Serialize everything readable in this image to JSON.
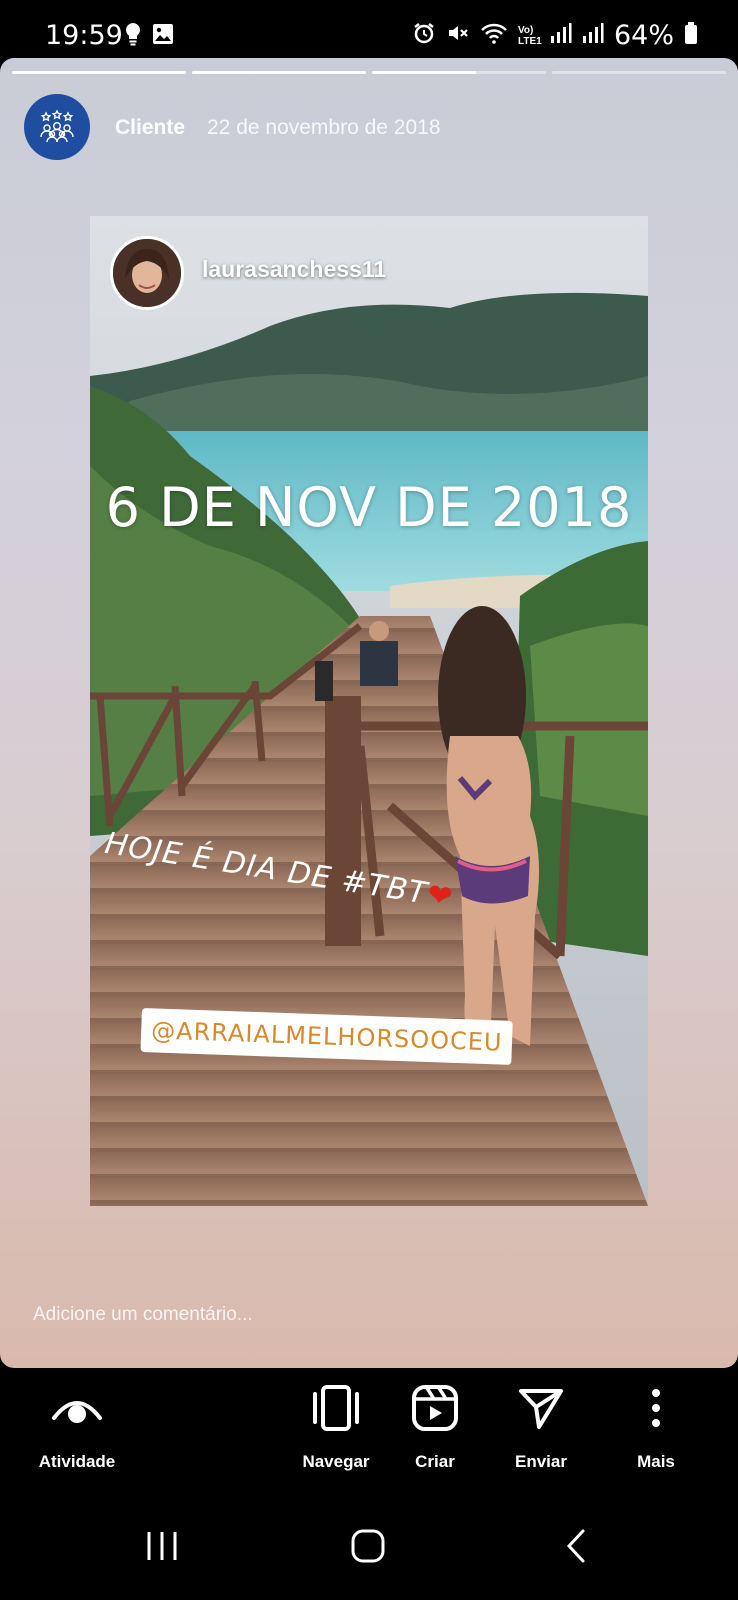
{
  "status_bar": {
    "time": "19:59",
    "battery": "64%",
    "network_label": "Vo) LTE1",
    "icons": [
      "bulb-icon",
      "image-icon",
      "alarm-icon",
      "mute-icon",
      "wifi-icon",
      "signal-icon",
      "signal-icon",
      "battery-icon"
    ]
  },
  "story": {
    "progress": [
      1.0,
      1.0,
      0.6,
      0.0
    ],
    "author": "Cliente",
    "date": "22 de novembro de 2018",
    "shared_post": {
      "username": "laurasanchess11",
      "date_stamp": "6 DE NOV DE 2018",
      "caption": "HOJE É DIA DE #TBT",
      "caption_emoji": "❤",
      "mention": "@ARRAIALMELHORSOOCEU"
    },
    "comment_placeholder": "Adicione um comentário..."
  },
  "actions": [
    {
      "label": "Atividade",
      "icon": "eye-icon"
    },
    {
      "label": "Navegar",
      "icon": "browse-icon"
    },
    {
      "label": "Criar",
      "icon": "reels-icon"
    },
    {
      "label": "Enviar",
      "icon": "send-icon"
    },
    {
      "label": "Mais",
      "icon": "more-icon"
    }
  ],
  "colors": {
    "avatar_blue": "#1f4da0",
    "mention_text": "#d68a2c",
    "heart": "#e0221b"
  }
}
